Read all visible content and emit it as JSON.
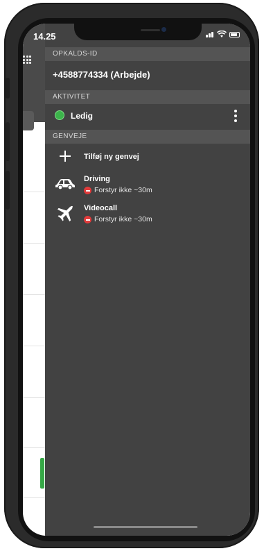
{
  "status_bar": {
    "time": "14.25"
  },
  "drawer": {
    "caller_id_header": "OPKALDS-ID",
    "caller_id": "+4588774334 (Arbejde)",
    "activity_header": "AKTIVITET",
    "activity_status": "Ledig",
    "activity_color": "#3cb44b",
    "shortcuts_header": "GENVEJE",
    "add_shortcut_label": "Tilføj ny genvej",
    "shortcuts": [
      {
        "title": "Driving",
        "icon": "car-icon",
        "status": "Forstyr ikke ~30m"
      },
      {
        "title": "Videocall",
        "icon": "airplane-icon",
        "status": "Forstyr ikke ~30m"
      }
    ]
  }
}
